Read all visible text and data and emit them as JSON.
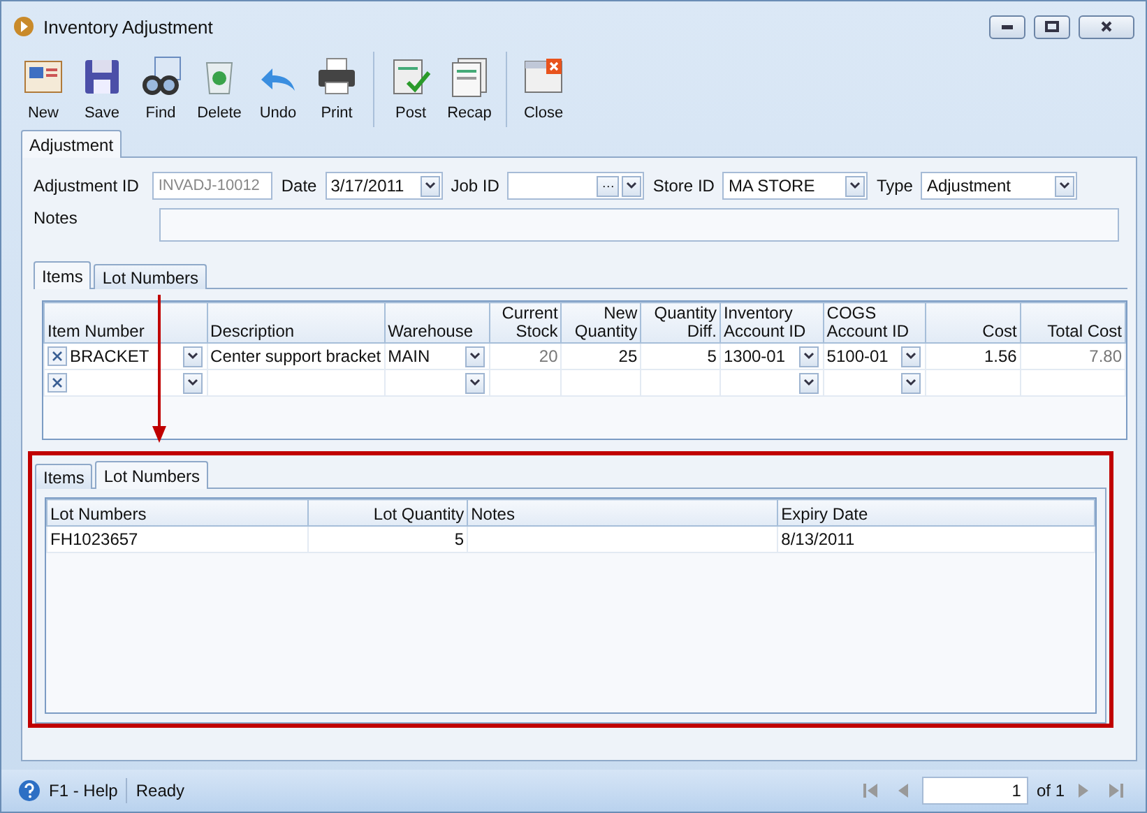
{
  "window": {
    "title": "Inventory Adjustment"
  },
  "toolbar": [
    [
      {
        "label": "New"
      },
      {
        "label": "Save"
      },
      {
        "label": "Find"
      },
      {
        "label": "Delete"
      },
      {
        "label": "Undo"
      },
      {
        "label": "Print"
      }
    ],
    [
      {
        "label": "Post"
      },
      {
        "label": "Recap"
      }
    ],
    [
      {
        "label": "Close"
      }
    ]
  ],
  "main_tabs": [
    {
      "label": "Adjustment",
      "selected": true
    }
  ],
  "form": {
    "adjustment_id": {
      "label": "Adjustment ID",
      "value": "INVADJ-10012",
      "disabled": true
    },
    "date": {
      "label": "Date",
      "value": "3/17/2011"
    },
    "job_id": {
      "label": "Job ID",
      "button": "···"
    },
    "store_id": {
      "label": "Store ID",
      "value": "MA STORE"
    },
    "type": {
      "label": "Type",
      "value": "Adjustment"
    },
    "notes": {
      "label": "Notes"
    }
  },
  "item_tabs": [
    {
      "label": "Items",
      "selected": true
    },
    {
      "label": "Lot Numbers",
      "selected": false
    }
  ],
  "items_grid": {
    "columns": [
      {
        "label": "Item Number",
        "kind": "lookup"
      },
      {
        "label": "Description",
        "kind": "text"
      },
      {
        "label": "Warehouse",
        "kind": "dropdown"
      },
      {
        "label": "Current\nStock",
        "kind": "readonly"
      },
      {
        "label": "New\nQuantity",
        "kind": "number"
      },
      {
        "label": "Quantity\nDiff.",
        "kind": "number"
      },
      {
        "label": "Inventory\nAccount ID",
        "kind": "dropdown"
      },
      {
        "label": "COGS\nAccount ID",
        "kind": "dropdown"
      },
      {
        "label": "Cost",
        "kind": "number"
      },
      {
        "label": "Total Cost",
        "kind": "readonly"
      }
    ],
    "rows": [
      [
        "BRACKET",
        "Center support bracket",
        "MAIN",
        "20",
        "25",
        "5",
        "1300-01",
        "5100-01",
        "1.56",
        "7.80"
      ],
      []
    ]
  },
  "callout": {
    "tabs": [
      {
        "label": "Items",
        "selected": false
      },
      {
        "label": "Lot Numbers",
        "selected": true
      }
    ],
    "columns": [
      {
        "label": "Lot Numbers",
        "kind": "text"
      },
      {
        "label": "Lot Quantity",
        "kind": "number"
      },
      {
        "label": "Notes",
        "kind": "text"
      },
      {
        "label": "Expiry Date",
        "kind": "text"
      }
    ],
    "rows": [
      [
        "FH1023657",
        "5",
        "",
        "8/13/2011"
      ]
    ]
  },
  "status_bar": {
    "help": "F1 - Help",
    "status": "Ready",
    "page": "1",
    "page_total": "of 1"
  }
}
